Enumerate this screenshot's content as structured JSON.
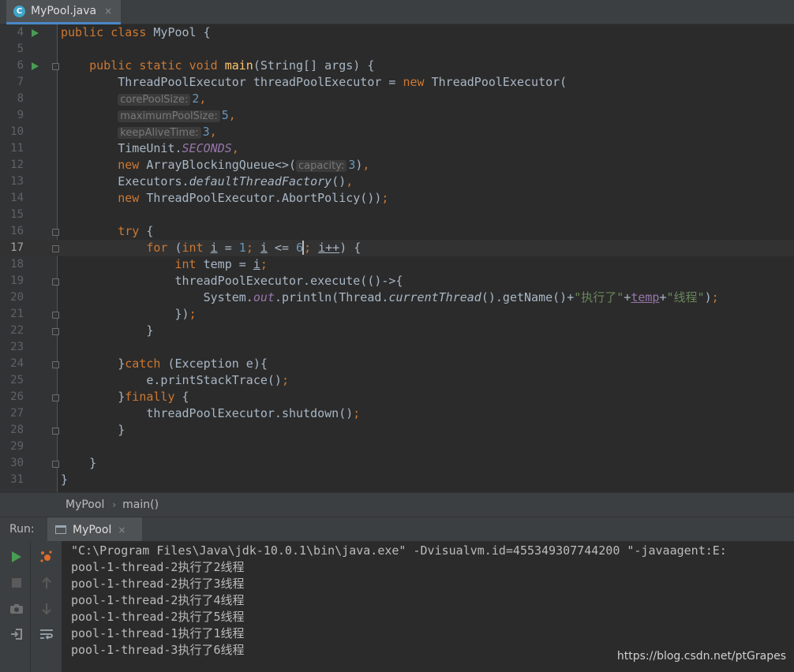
{
  "tab": {
    "icon": "C",
    "label": "MyPool.java",
    "close": "×"
  },
  "breadcrumb": {
    "class_name": "MyPool",
    "method": "main()",
    "separator": "›"
  },
  "run_panel": {
    "label": "Run:",
    "tab_label": "MyPool",
    "tab_close": "×"
  },
  "tool_icons": [
    "run-icon",
    "stop-icon",
    "camera-icon",
    "login-icon",
    "debug-icon",
    "up-arrow-icon",
    "down-arrow-icon",
    "soft-wrap-icon"
  ],
  "line_numbers": [
    "4",
    "5",
    "6",
    "7",
    "8",
    "9",
    "10",
    "11",
    "12",
    "13",
    "14",
    "15",
    "16",
    "17",
    "18",
    "19",
    "20",
    "21",
    "22",
    "23",
    "24",
    "25",
    "26",
    "27",
    "28",
    "29",
    "30",
    "31"
  ],
  "code": {
    "l4": {
      "kw1": "public",
      "kw2": "class",
      "name": "MyPool",
      "brace": "{"
    },
    "l6": {
      "kw1": "public",
      "kw2": "static",
      "kw3": "void",
      "fn": "main",
      "params": "(String[] args) {"
    },
    "l7": {
      "type": "ThreadPoolExecutor threadPoolExecutor = ",
      "kw": "new",
      "rest": " ThreadPoolExecutor("
    },
    "l8": {
      "hint": "corePoolSize:",
      "num": "2",
      "punct": ","
    },
    "l9": {
      "hint": "maximumPoolSize:",
      "num": "5",
      "punct": ","
    },
    "l10": {
      "hint": "keepAliveTime:",
      "num": "3",
      "punct": ","
    },
    "l11": {
      "pre": "TimeUnit.",
      "field": "SECONDS",
      "punct": ","
    },
    "l12": {
      "kw": "new",
      "pre": " ArrayBlockingQueue<>(",
      "hint": "capacity:",
      "num": "3",
      "post": ")",
      "punct": ","
    },
    "l13": {
      "pre": "Executors.",
      "method": "defaultThreadFactory",
      "post": "()",
      "punct": ","
    },
    "l14": {
      "kw": "new",
      "rest": " ThreadPoolExecutor.AbortPolicy())",
      "punct": ";"
    },
    "l16": {
      "kw": "try",
      "rest": " {"
    },
    "l17": {
      "kw1": "for",
      "t1": " (",
      "kw2": "int",
      "v1": "i",
      "t2": " = ",
      "n1": "1",
      "p1": ";",
      "v2": "i",
      "t3": " <= ",
      "n2a": "6",
      "p2": ";",
      "v3": "i++",
      "t4": ") {"
    },
    "l18": {
      "kw": "int",
      "t1": " temp = ",
      "v": "i",
      "p": ";"
    },
    "l19": {
      "text": "threadPoolExecutor.execute(()->{"
    },
    "l20": {
      "t1": "System.",
      "field": "out",
      "t2": ".println(Thread.",
      "method": "currentThread",
      "t3": "().getName()+",
      "s1": "\"执行了\"",
      "t4": "+",
      "v": "temp",
      "t5": "+",
      "s2": "\"线程\"",
      "t6": ")",
      "p": ";"
    },
    "l21": {
      "text": "})",
      "p": ";"
    },
    "l22": {
      "text": "}"
    },
    "l24": {
      "t1": "}",
      "kw": "catch",
      "t2": " (Exception e){"
    },
    "l25": {
      "text": "e.printStackTrace()",
      "p": ";"
    },
    "l26": {
      "t1": "}",
      "kw": "finally",
      "t2": " {"
    },
    "l27": {
      "text": "threadPoolExecutor.shutdown()",
      "p": ";"
    },
    "l28": {
      "text": "}"
    },
    "l30": {
      "text": "}"
    },
    "l31": {
      "text": "}"
    }
  },
  "console_lines": [
    "\"C:\\Program Files\\Java\\jdk-10.0.1\\bin\\java.exe\" -Dvisualvm.id=455349307744200 \"-javaagent:E:",
    "pool-1-thread-2执行了2线程",
    "pool-1-thread-2执行了3线程",
    "pool-1-thread-2执行了4线程",
    "pool-1-thread-2执行了5线程",
    "pool-1-thread-1执行了1线程",
    "pool-1-thread-3执行了6线程"
  ],
  "watermark": "https://blog.csdn.net/ptGrapes",
  "colors": {
    "keyword": "#cc7832",
    "function": "#ffc66d",
    "string": "#6a8759",
    "number": "#6897bb",
    "field": "#9876aa",
    "text": "#a9b7c6",
    "background": "#2b2b2b",
    "run_green": "#499c54"
  }
}
